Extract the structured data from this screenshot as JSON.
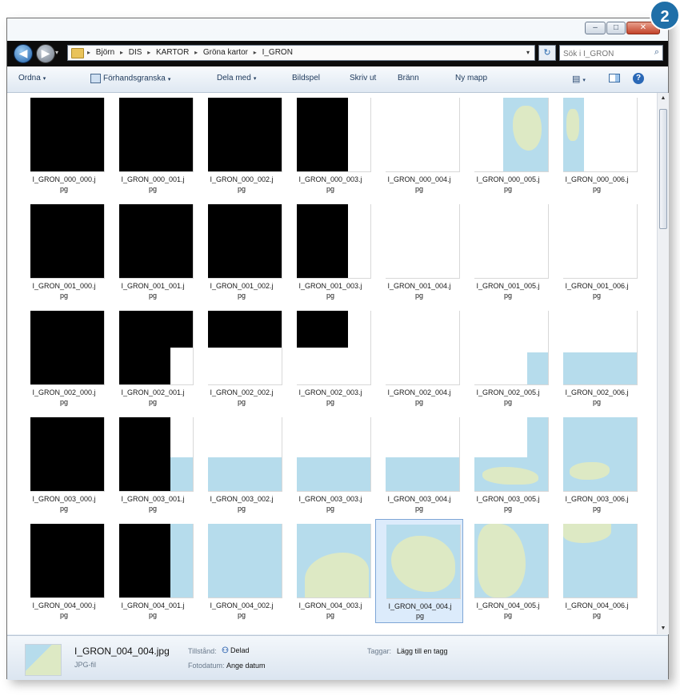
{
  "badge": "2",
  "window_controls": {
    "minimize": "–",
    "maximize": "□",
    "close": "✕"
  },
  "breadcrumbs": [
    "Björn",
    "DIS",
    "KARTOR",
    "Gröna kartor",
    "I_GRON"
  ],
  "breadcrumb_separator": "▸",
  "search": {
    "placeholder": "Sök i I_GRON"
  },
  "toolbar": {
    "organize": "Ordna",
    "preview": "Förhandsgranska",
    "share": "Dela med",
    "slideshow": "Bildspel",
    "print": "Skriv ut",
    "burn": "Bränn",
    "new_folder": "Ny mapp"
  },
  "icons": {
    "back": "◀",
    "forward": "▶",
    "dropdown": "▾",
    "refresh": "↻",
    "search": "⌕",
    "views": "▤",
    "help": "?",
    "scroll_up": "▲",
    "scroll_down": "▼"
  },
  "files": [
    [
      {
        "line1": "I_GRON_000_000.j",
        "line2": "pg"
      },
      {
        "line1": "I_GRON_000_001.j",
        "line2": "pg"
      },
      {
        "line1": "I_GRON_000_002.j",
        "line2": "pg"
      },
      {
        "line1": "I_GRON_000_003.j",
        "line2": "pg"
      },
      {
        "line1": "I_GRON_000_004.j",
        "line2": "pg"
      },
      {
        "line1": "I_GRON_000_005.j",
        "line2": "pg"
      },
      {
        "line1": "I_GRON_000_006.j",
        "line2": "pg"
      }
    ],
    [
      {
        "line1": "I_GRON_001_000.j",
        "line2": "pg"
      },
      {
        "line1": "I_GRON_001_001.j",
        "line2": "pg"
      },
      {
        "line1": "I_GRON_001_002.j",
        "line2": "pg"
      },
      {
        "line1": "I_GRON_001_003.j",
        "line2": "pg"
      },
      {
        "line1": "I_GRON_001_004.j",
        "line2": "pg"
      },
      {
        "line1": "I_GRON_001_005.j",
        "line2": "pg"
      },
      {
        "line1": "I_GRON_001_006.j",
        "line2": "pg"
      }
    ],
    [
      {
        "line1": "I_GRON_002_000.j",
        "line2": "pg"
      },
      {
        "line1": "I_GRON_002_001.j",
        "line2": "pg"
      },
      {
        "line1": "I_GRON_002_002.j",
        "line2": "pg"
      },
      {
        "line1": "I_GRON_002_003.j",
        "line2": "pg"
      },
      {
        "line1": "I_GRON_002_004.j",
        "line2": "pg"
      },
      {
        "line1": "I_GRON_002_005.j",
        "line2": "pg"
      },
      {
        "line1": "I_GRON_002_006.j",
        "line2": "pg"
      }
    ],
    [
      {
        "line1": "I_GRON_003_000.j",
        "line2": "pg"
      },
      {
        "line1": "I_GRON_003_001.j",
        "line2": "pg"
      },
      {
        "line1": "I_GRON_003_002.j",
        "line2": "pg"
      },
      {
        "line1": "I_GRON_003_003.j",
        "line2": "pg"
      },
      {
        "line1": "I_GRON_003_004.j",
        "line2": "pg"
      },
      {
        "line1": "I_GRON_003_005.j",
        "line2": "pg"
      },
      {
        "line1": "I_GRON_003_006.j",
        "line2": "pg"
      }
    ],
    [
      {
        "line1": "I_GRON_004_000.j",
        "line2": "pg"
      },
      {
        "line1": "I_GRON_004_001.j",
        "line2": "pg"
      },
      {
        "line1": "I_GRON_004_002.j",
        "line2": "pg"
      },
      {
        "line1": "I_GRON_004_003.j",
        "line2": "pg"
      },
      {
        "line1": "I_GRON_004_004.j",
        "line2": "pg",
        "selected": true
      },
      {
        "line1": "I_GRON_004_005.j",
        "line2": "pg"
      },
      {
        "line1": "I_GRON_004_006.j",
        "line2": "pg"
      }
    ]
  ],
  "details": {
    "filename": "I_GRON_004_004.jpg",
    "filetype": "JPG-fil",
    "state_label": "Tillstånd:",
    "state_value": "Delad",
    "date_label": "Fotodatum:",
    "date_value": "Ange datum",
    "tags_label": "Taggar:",
    "tags_value": "Lägg till en tagg"
  }
}
